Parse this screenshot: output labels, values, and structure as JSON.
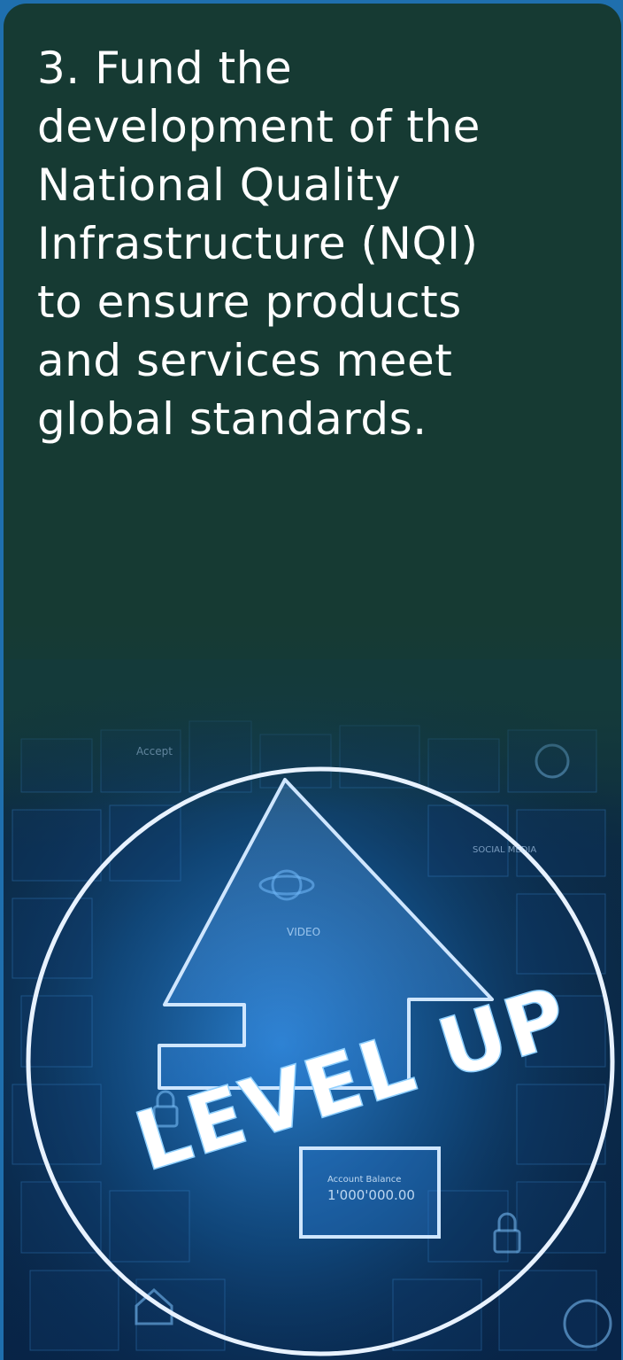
{
  "headline": {
    "lines": [
      "3. Fund the",
      "development of the",
      "National Quality",
      "Infrastructure (NQI)",
      "to ensure products",
      "and services meet",
      "global standards."
    ]
  },
  "illustration": {
    "badge_text": "LEVEL UP",
    "tile_labels": [
      "VIDEO",
      "SOCIAL MEDIA",
      "Accept"
    ],
    "balance_label": "Account Balance",
    "balance_value": "1'000'000.00"
  },
  "colors": {
    "page_border": "#1f6fae",
    "card_background": "#163a33",
    "glow": "#3fa4ff",
    "text": "#ffffff"
  }
}
